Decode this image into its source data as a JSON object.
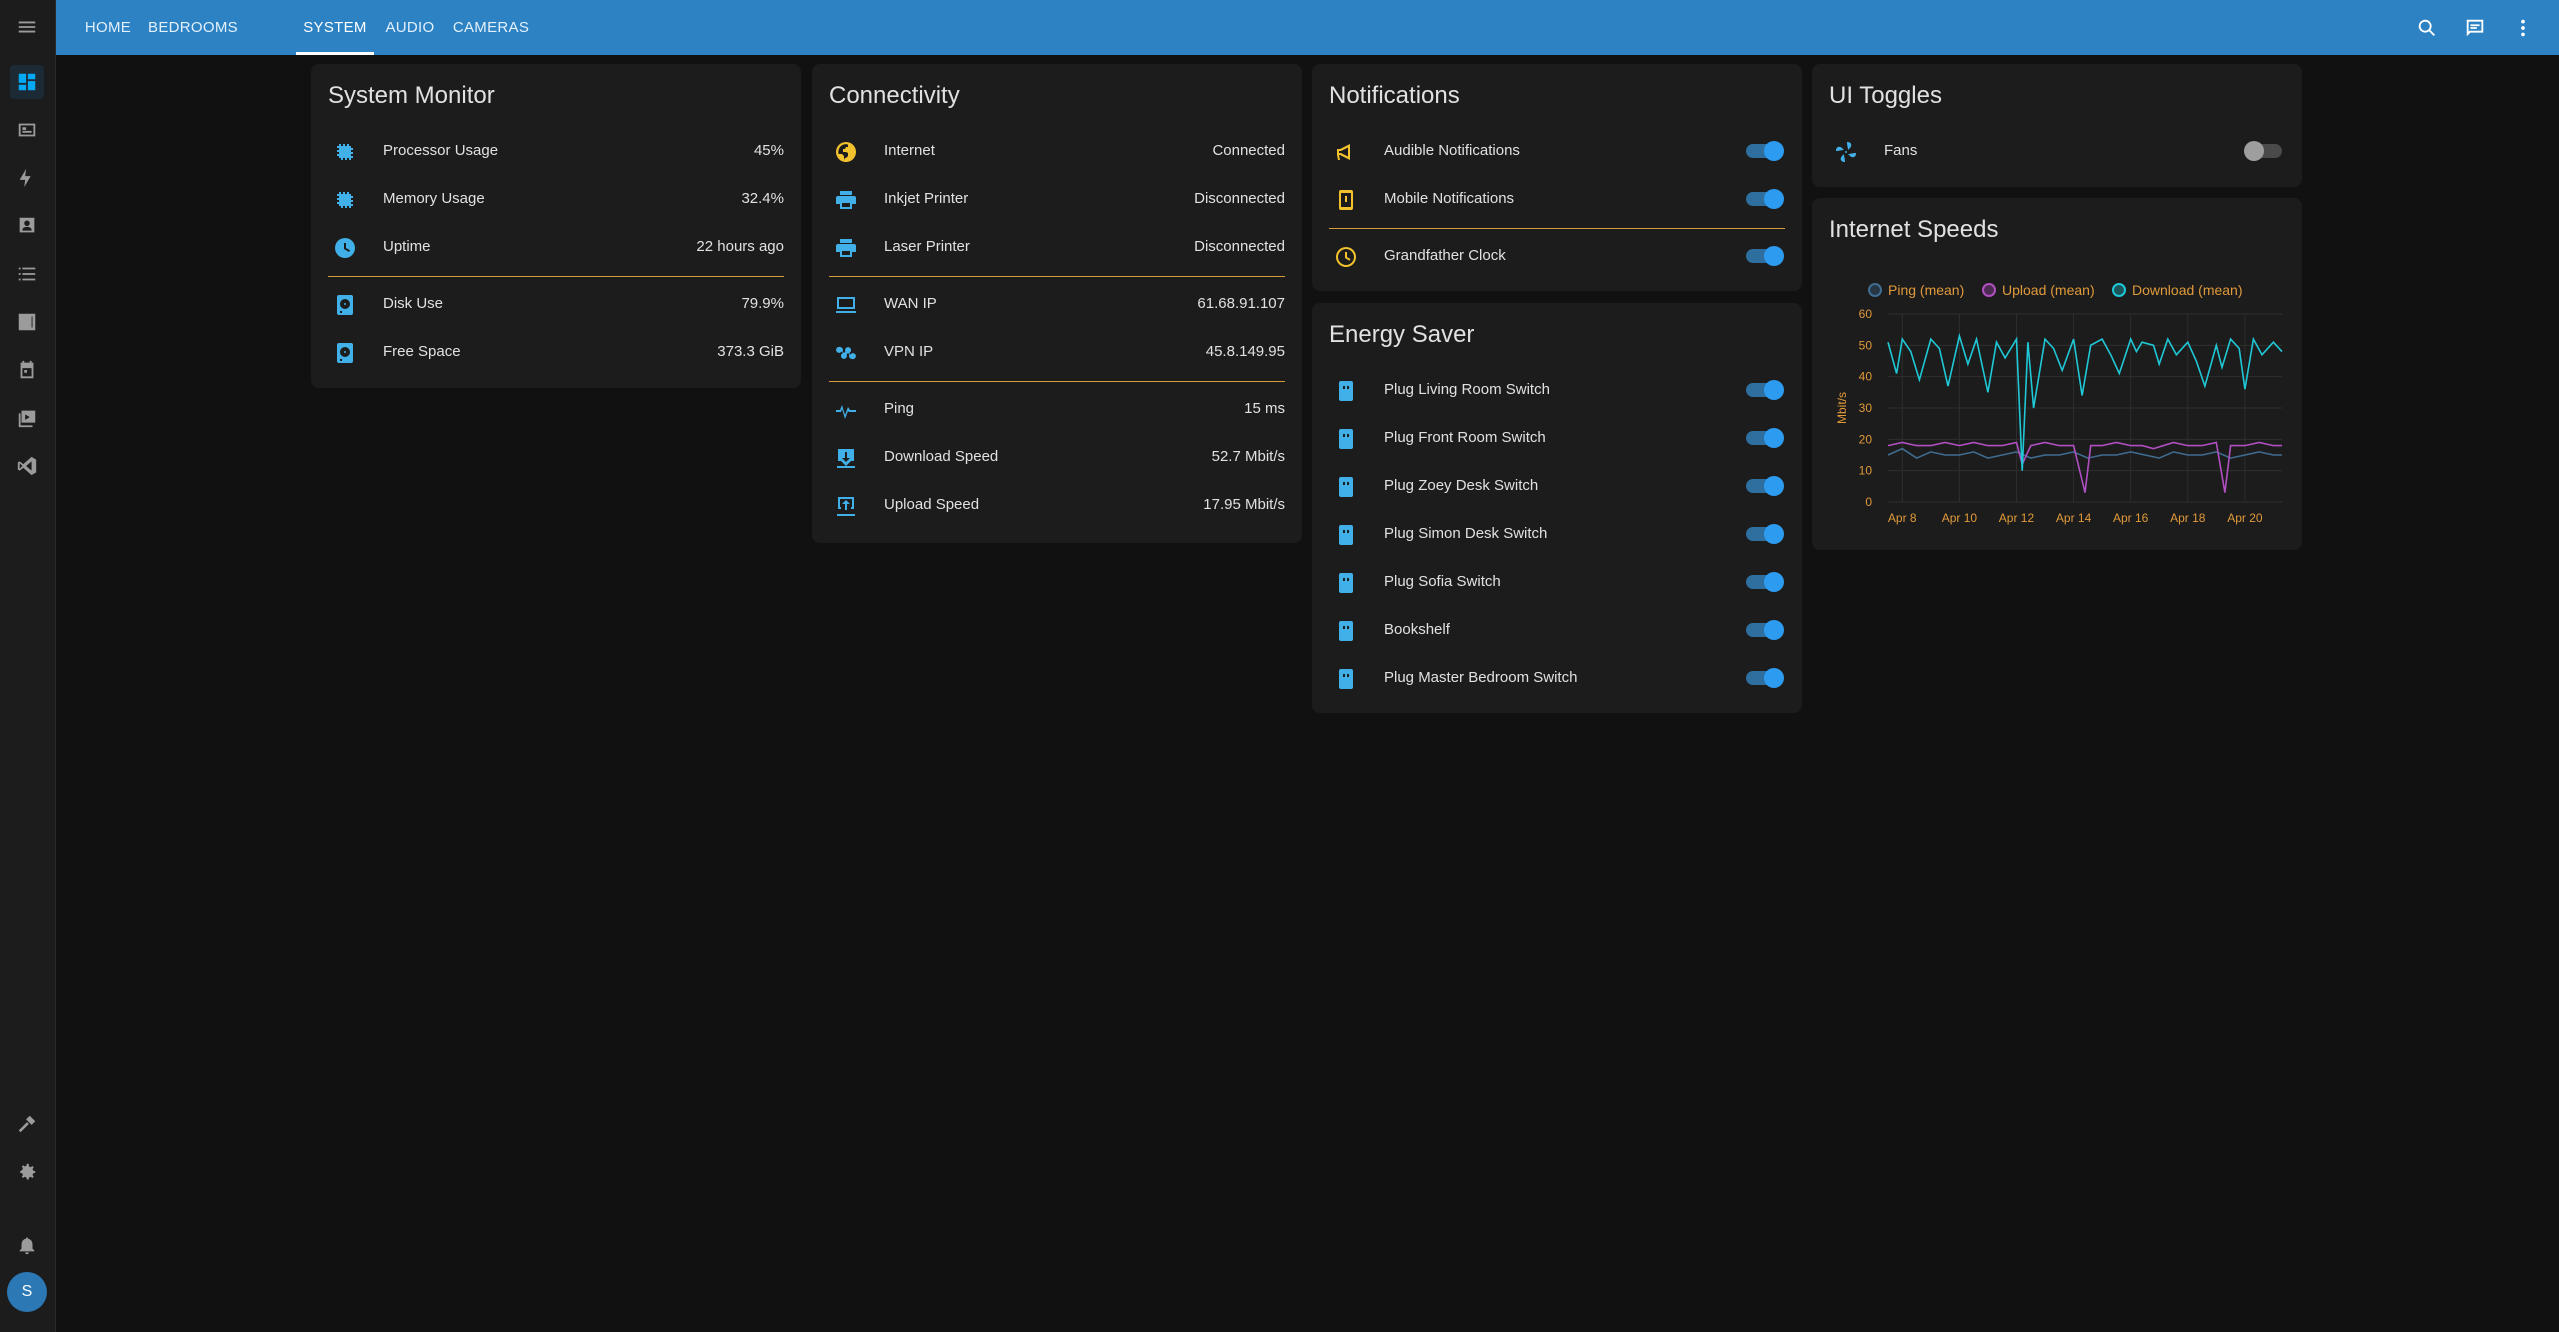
{
  "nav": {
    "tabs": [
      "HOME",
      "BEDROOMS",
      "SYSTEM",
      "AUDIO",
      "CAMERAS"
    ],
    "active_tab": "SYSTEM"
  },
  "user": {
    "avatar_initial": "S"
  },
  "system_monitor": {
    "title": "System Monitor",
    "rows": [
      {
        "icon": "cpu-icon",
        "label": "Processor Usage",
        "value": "45%"
      },
      {
        "icon": "memory-icon",
        "label": "Memory Usage",
        "value": "32.4%"
      },
      {
        "icon": "clock-icon",
        "label": "Uptime",
        "value": "22 hours ago"
      },
      {
        "icon": "harddisk-icon",
        "label": "Disk Use",
        "value": "79.9%"
      },
      {
        "icon": "harddisk-icon",
        "label": "Free Space",
        "value": "373.3 GiB"
      }
    ]
  },
  "connectivity": {
    "title": "Connectivity",
    "rows": [
      {
        "icon": "globe-icon",
        "label": "Internet",
        "value": "Connected"
      },
      {
        "icon": "printer-icon",
        "label": "Inkjet Printer",
        "value": "Disconnected"
      },
      {
        "icon": "printer-icon",
        "label": "Laser Printer",
        "value": "Disconnected"
      },
      {
        "icon": "monitor-icon",
        "label": "WAN IP",
        "value": "61.68.91.107"
      },
      {
        "icon": "vpn-icon",
        "label": "VPN IP",
        "value": "45.8.149.95"
      },
      {
        "icon": "pulse-icon",
        "label": "Ping",
        "value": "15 ms"
      },
      {
        "icon": "download-icon",
        "label": "Download Speed",
        "value": "52.7 Mbit/s"
      },
      {
        "icon": "upload-icon",
        "label": "Upload Speed",
        "value": "17.95 Mbit/s"
      }
    ]
  },
  "notifications": {
    "title": "Notifications",
    "rows": [
      {
        "icon": "bullhorn-icon",
        "label": "Audible Notifications",
        "on": true
      },
      {
        "icon": "cellphone-icon",
        "label": "Mobile Notifications",
        "on": true
      },
      {
        "icon": "clock-outline-icon",
        "label": "Grandfather Clock",
        "on": true
      }
    ]
  },
  "energy_saver": {
    "title": "Energy Saver",
    "rows": [
      {
        "icon": "power-socket-icon",
        "label": "Plug Living Room Switch",
        "on": true
      },
      {
        "icon": "power-socket-icon",
        "label": "Plug Front Room Switch",
        "on": true
      },
      {
        "icon": "power-socket-icon",
        "label": "Plug Zoey Desk Switch",
        "on": true
      },
      {
        "icon": "power-socket-icon",
        "label": "Plug Simon Desk Switch",
        "on": true
      },
      {
        "icon": "power-socket-icon",
        "label": "Plug Sofia Switch",
        "on": true
      },
      {
        "icon": "power-socket-icon",
        "label": "Bookshelf",
        "on": true
      },
      {
        "icon": "power-socket-icon",
        "label": "Plug Master Bedroom Switch",
        "on": true
      }
    ]
  },
  "ui_toggles": {
    "title": "UI Toggles",
    "rows": [
      {
        "icon": "fan-icon",
        "label": "Fans",
        "on": false
      }
    ]
  },
  "internet_speeds": {
    "title": "Internet Speeds",
    "colors": {
      "ping": "#3f6d92",
      "upload": "#b14fc2",
      "download": "#1fc8d6",
      "axis_text": "#e09a3a"
    }
  },
  "chart_data": {
    "type": "line",
    "ylabel": "Mbit/s",
    "ylim": [
      0,
      60
    ],
    "yticks": [
      0,
      10,
      20,
      30,
      40,
      50,
      60
    ],
    "xticks": [
      "Apr 8",
      "Apr 10",
      "Apr 12",
      "Apr 14",
      "Apr 16",
      "Apr 18",
      "Apr 20"
    ],
    "xlim": [
      7.5,
      21.3
    ],
    "legend_position": "top",
    "series": [
      {
        "name": "Ping (mean)",
        "x": [
          7.5,
          8,
          8.5,
          9,
          9.5,
          10,
          10.5,
          11,
          11.5,
          12,
          12.5,
          13,
          13.5,
          14,
          14.5,
          15,
          15.5,
          16,
          16.5,
          17,
          17.5,
          18,
          18.5,
          19,
          19.5,
          20,
          20.5,
          21,
          21.3
        ],
        "y": [
          15,
          17,
          14,
          16,
          15,
          15,
          16,
          14,
          15,
          16,
          14,
          15,
          15,
          16,
          14,
          15,
          15,
          16,
          15,
          14,
          16,
          15,
          15,
          16,
          14,
          15,
          16,
          15,
          15
        ]
      },
      {
        "name": "Upload (mean)",
        "x": [
          7.5,
          8,
          8.5,
          9,
          9.5,
          10,
          10.5,
          11,
          11.5,
          12,
          12.2,
          12.5,
          13,
          13.5,
          14,
          14.4,
          14.6,
          15,
          15.5,
          16,
          16.4,
          16.8,
          17.5,
          18,
          18.5,
          19,
          19.3,
          19.5,
          20,
          20.5,
          21,
          21.3
        ],
        "y": [
          18,
          19,
          18,
          18,
          19,
          18,
          19,
          18,
          18,
          19,
          12,
          18,
          19,
          18,
          18,
          3,
          18,
          18,
          19,
          18,
          18,
          17,
          19,
          18,
          18,
          19,
          3,
          18,
          18,
          19,
          18,
          18
        ]
      },
      {
        "name": "Download (mean)",
        "x": [
          7.5,
          7.8,
          8,
          8.3,
          8.6,
          9,
          9.3,
          9.6,
          10,
          10.3,
          10.6,
          11,
          11.3,
          11.6,
          12,
          12.2,
          12.4,
          12.6,
          13,
          13.3,
          13.6,
          14,
          14.3,
          14.6,
          15,
          15.3,
          15.6,
          16,
          16.2,
          16.4,
          16.8,
          17,
          17.3,
          17.6,
          18,
          18.3,
          18.6,
          19,
          19.2,
          19.5,
          19.8,
          20,
          20.3,
          20.6,
          21,
          21.3
        ],
        "y": [
          51,
          41,
          52,
          48,
          39,
          52,
          49,
          37,
          53,
          44,
          52,
          35,
          51,
          46,
          52,
          10,
          51,
          30,
          52,
          49,
          42,
          52,
          34,
          50,
          52,
          47,
          41,
          52,
          48,
          51,
          50,
          44,
          52,
          47,
          51,
          45,
          37,
          50,
          43,
          52,
          49,
          36,
          52,
          47,
          51,
          48
        ]
      }
    ]
  }
}
